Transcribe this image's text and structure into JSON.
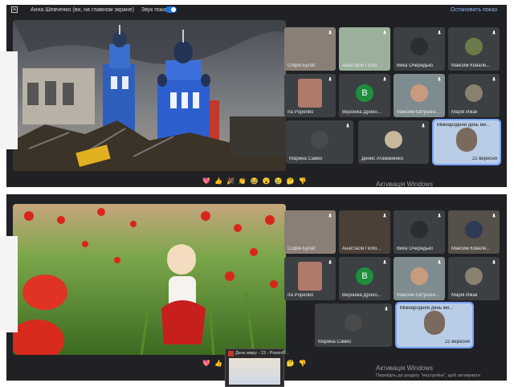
{
  "top_bar": {
    "presenter": "Анна Шевченко (ви, на главном экране)",
    "sound_label": "Звук показа",
    "stop_label": "Остановить показ"
  },
  "participants_top": [
    "Софія Булат",
    "Анастасія Попо...",
    "Вика Очередько",
    "Максим Ковале...",
    "Ira Popenko",
    "Вероніка Дроно...",
    "Максим Євтушен...",
    "Марія Ижак",
    "Марина Самко",
    "Денис Атаманенко",
    "Міжнародний день ми..."
  ],
  "participants_bottom": [
    "Софія Булат",
    "Анастасія Попо...",
    "Вика Очередько",
    "Максим Ковале...",
    "Ira Popenko",
    "Вероніка Дроно...",
    "Максим Євтушен...",
    "Марія Ижак",
    "Марина Самко",
    "Міжнародний день ми..."
  ],
  "avatar_letter": "В",
  "slide_date": "21 вересня",
  "reactions": [
    "💖",
    "👍",
    "🎉",
    "👏",
    "😂",
    "😮",
    "😢",
    "🤔",
    "👎"
  ],
  "activation": {
    "title": "Активація Windows",
    "subtitle": "Перейдіть до розділу \"Настройки\", щоб активувати"
  },
  "ppt_popup": {
    "title": "День миру - 23 - PowerP..."
  },
  "colors": {
    "accent": "#1a73e8",
    "tile": "#3c4043",
    "bg": "#202124",
    "avatar_green": "#1e8e3e"
  }
}
